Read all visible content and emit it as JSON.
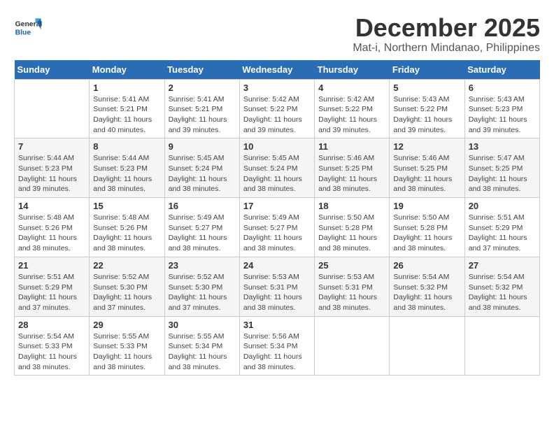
{
  "header": {
    "logo_general": "General",
    "logo_blue": "Blue",
    "month": "December 2025",
    "location": "Mat-i, Northern Mindanao, Philippines"
  },
  "days_of_week": [
    "Sunday",
    "Monday",
    "Tuesday",
    "Wednesday",
    "Thursday",
    "Friday",
    "Saturday"
  ],
  "weeks": [
    [
      {
        "day": "",
        "info": ""
      },
      {
        "day": "1",
        "info": "Sunrise: 5:41 AM\nSunset: 5:21 PM\nDaylight: 11 hours\nand 40 minutes."
      },
      {
        "day": "2",
        "info": "Sunrise: 5:41 AM\nSunset: 5:21 PM\nDaylight: 11 hours\nand 39 minutes."
      },
      {
        "day": "3",
        "info": "Sunrise: 5:42 AM\nSunset: 5:22 PM\nDaylight: 11 hours\nand 39 minutes."
      },
      {
        "day": "4",
        "info": "Sunrise: 5:42 AM\nSunset: 5:22 PM\nDaylight: 11 hours\nand 39 minutes."
      },
      {
        "day": "5",
        "info": "Sunrise: 5:43 AM\nSunset: 5:22 PM\nDaylight: 11 hours\nand 39 minutes."
      },
      {
        "day": "6",
        "info": "Sunrise: 5:43 AM\nSunset: 5:23 PM\nDaylight: 11 hours\nand 39 minutes."
      }
    ],
    [
      {
        "day": "7",
        "info": "Sunrise: 5:44 AM\nSunset: 5:23 PM\nDaylight: 11 hours\nand 39 minutes."
      },
      {
        "day": "8",
        "info": "Sunrise: 5:44 AM\nSunset: 5:23 PM\nDaylight: 11 hours\nand 38 minutes."
      },
      {
        "day": "9",
        "info": "Sunrise: 5:45 AM\nSunset: 5:24 PM\nDaylight: 11 hours\nand 38 minutes."
      },
      {
        "day": "10",
        "info": "Sunrise: 5:45 AM\nSunset: 5:24 PM\nDaylight: 11 hours\nand 38 minutes."
      },
      {
        "day": "11",
        "info": "Sunrise: 5:46 AM\nSunset: 5:25 PM\nDaylight: 11 hours\nand 38 minutes."
      },
      {
        "day": "12",
        "info": "Sunrise: 5:46 AM\nSunset: 5:25 PM\nDaylight: 11 hours\nand 38 minutes."
      },
      {
        "day": "13",
        "info": "Sunrise: 5:47 AM\nSunset: 5:25 PM\nDaylight: 11 hours\nand 38 minutes."
      }
    ],
    [
      {
        "day": "14",
        "info": "Sunrise: 5:48 AM\nSunset: 5:26 PM\nDaylight: 11 hours\nand 38 minutes."
      },
      {
        "day": "15",
        "info": "Sunrise: 5:48 AM\nSunset: 5:26 PM\nDaylight: 11 hours\nand 38 minutes."
      },
      {
        "day": "16",
        "info": "Sunrise: 5:49 AM\nSunset: 5:27 PM\nDaylight: 11 hours\nand 38 minutes."
      },
      {
        "day": "17",
        "info": "Sunrise: 5:49 AM\nSunset: 5:27 PM\nDaylight: 11 hours\nand 38 minutes."
      },
      {
        "day": "18",
        "info": "Sunrise: 5:50 AM\nSunset: 5:28 PM\nDaylight: 11 hours\nand 38 minutes."
      },
      {
        "day": "19",
        "info": "Sunrise: 5:50 AM\nSunset: 5:28 PM\nDaylight: 11 hours\nand 38 minutes."
      },
      {
        "day": "20",
        "info": "Sunrise: 5:51 AM\nSunset: 5:29 PM\nDaylight: 11 hours\nand 37 minutes."
      }
    ],
    [
      {
        "day": "21",
        "info": "Sunrise: 5:51 AM\nSunset: 5:29 PM\nDaylight: 11 hours\nand 37 minutes."
      },
      {
        "day": "22",
        "info": "Sunrise: 5:52 AM\nSunset: 5:30 PM\nDaylight: 11 hours\nand 37 minutes."
      },
      {
        "day": "23",
        "info": "Sunrise: 5:52 AM\nSunset: 5:30 PM\nDaylight: 11 hours\nand 37 minutes."
      },
      {
        "day": "24",
        "info": "Sunrise: 5:53 AM\nSunset: 5:31 PM\nDaylight: 11 hours\nand 38 minutes."
      },
      {
        "day": "25",
        "info": "Sunrise: 5:53 AM\nSunset: 5:31 PM\nDaylight: 11 hours\nand 38 minutes."
      },
      {
        "day": "26",
        "info": "Sunrise: 5:54 AM\nSunset: 5:32 PM\nDaylight: 11 hours\nand 38 minutes."
      },
      {
        "day": "27",
        "info": "Sunrise: 5:54 AM\nSunset: 5:32 PM\nDaylight: 11 hours\nand 38 minutes."
      }
    ],
    [
      {
        "day": "28",
        "info": "Sunrise: 5:54 AM\nSunset: 5:33 PM\nDaylight: 11 hours\nand 38 minutes."
      },
      {
        "day": "29",
        "info": "Sunrise: 5:55 AM\nSunset: 5:33 PM\nDaylight: 11 hours\nand 38 minutes."
      },
      {
        "day": "30",
        "info": "Sunrise: 5:55 AM\nSunset: 5:34 PM\nDaylight: 11 hours\nand 38 minutes."
      },
      {
        "day": "31",
        "info": "Sunrise: 5:56 AM\nSunset: 5:34 PM\nDaylight: 11 hours\nand 38 minutes."
      },
      {
        "day": "",
        "info": ""
      },
      {
        "day": "",
        "info": ""
      },
      {
        "day": "",
        "info": ""
      }
    ]
  ]
}
